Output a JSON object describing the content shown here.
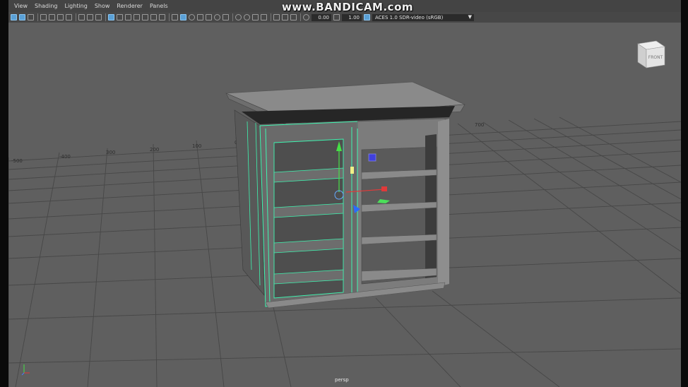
{
  "menubar": {
    "items": [
      "View",
      "Shading",
      "Lighting",
      "Show",
      "Renderer",
      "Panels"
    ]
  },
  "watermark": "www.BANDICAM.com",
  "toolbar": {
    "field_a": "0.00",
    "field_b": "1.00",
    "color_space": "ACES 1.0 SDR-video (sRGB)"
  },
  "grid": {
    "labels": [
      "-500",
      "-400",
      "300",
      "200",
      "100",
      "0",
      "700"
    ]
  },
  "viewcube": {
    "face_label": "FRONT"
  },
  "camera": {
    "label": "persp"
  },
  "colors": {
    "viewport": "#5f5f5f",
    "selection": "#3ef5b0",
    "grid": "#474747"
  },
  "icons": [
    "select-icon",
    "lasso-icon",
    "camera-icon",
    "grid-icon",
    "wireframe-icon",
    "shaded-icon",
    "light-icon",
    "isolate-icon",
    "exposure-icon",
    "gamma-icon",
    "colorspace-icon"
  ]
}
